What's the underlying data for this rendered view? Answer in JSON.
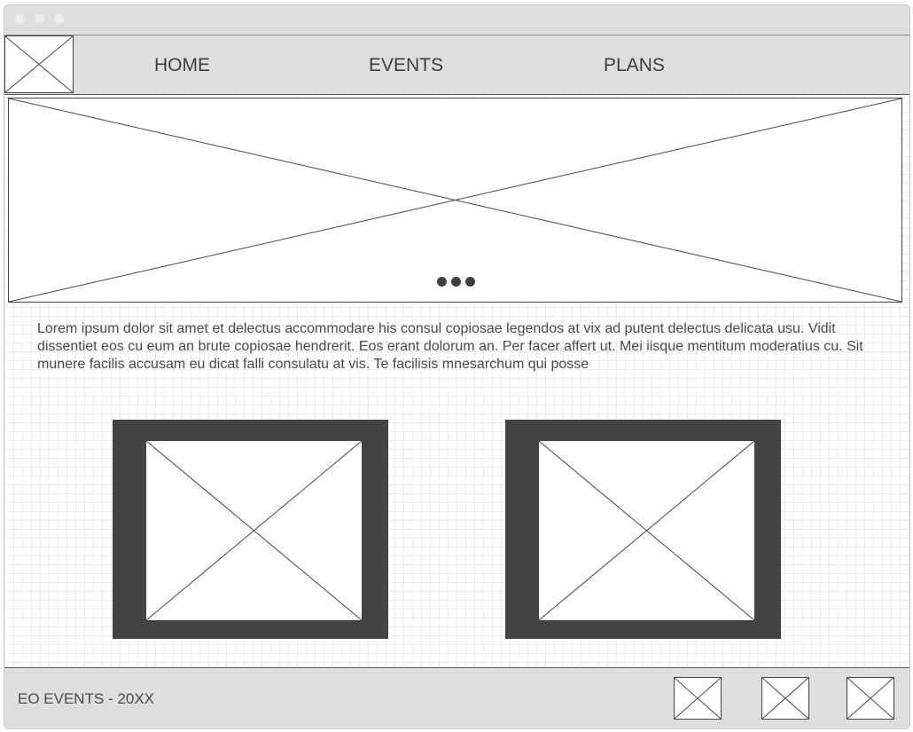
{
  "window": {
    "controls": [
      "close",
      "minimize",
      "maximize"
    ]
  },
  "header": {
    "logo_icon": "image-placeholder-icon",
    "nav": [
      {
        "label": "HOME"
      },
      {
        "label": "EVENTS"
      },
      {
        "label": "PLANS"
      }
    ]
  },
  "hero": {
    "icon": "image-placeholder-icon",
    "carousel_dots": 3
  },
  "content": {
    "paragraph": "Lorem ipsum dolor sit amet et delectus accommodare his consul copiosae legendos at vix ad putent delectus delicata usu. Vidit dissentiet eos cu eum an brute copiosae hendrerit. Eos erant dolorum an. Per facer affert ut. Mei iisque mentitum moderatius cu. Sit munere facilis accusam eu dicat falli consulatu at vis. Te facilisis mnesarchum qui posse"
  },
  "cards": [
    {
      "icon": "image-placeholder-icon"
    },
    {
      "icon": "image-placeholder-icon"
    }
  ],
  "footer": {
    "text": "EO EVENTS - 20XX",
    "social_icons": [
      "image-placeholder-icon",
      "image-placeholder-icon",
      "image-placeholder-icon"
    ]
  },
  "colors": {
    "chrome_gray": "#dedede",
    "card_dark": "#434343",
    "text": "#4a4a4a",
    "grid": "#ececec"
  }
}
